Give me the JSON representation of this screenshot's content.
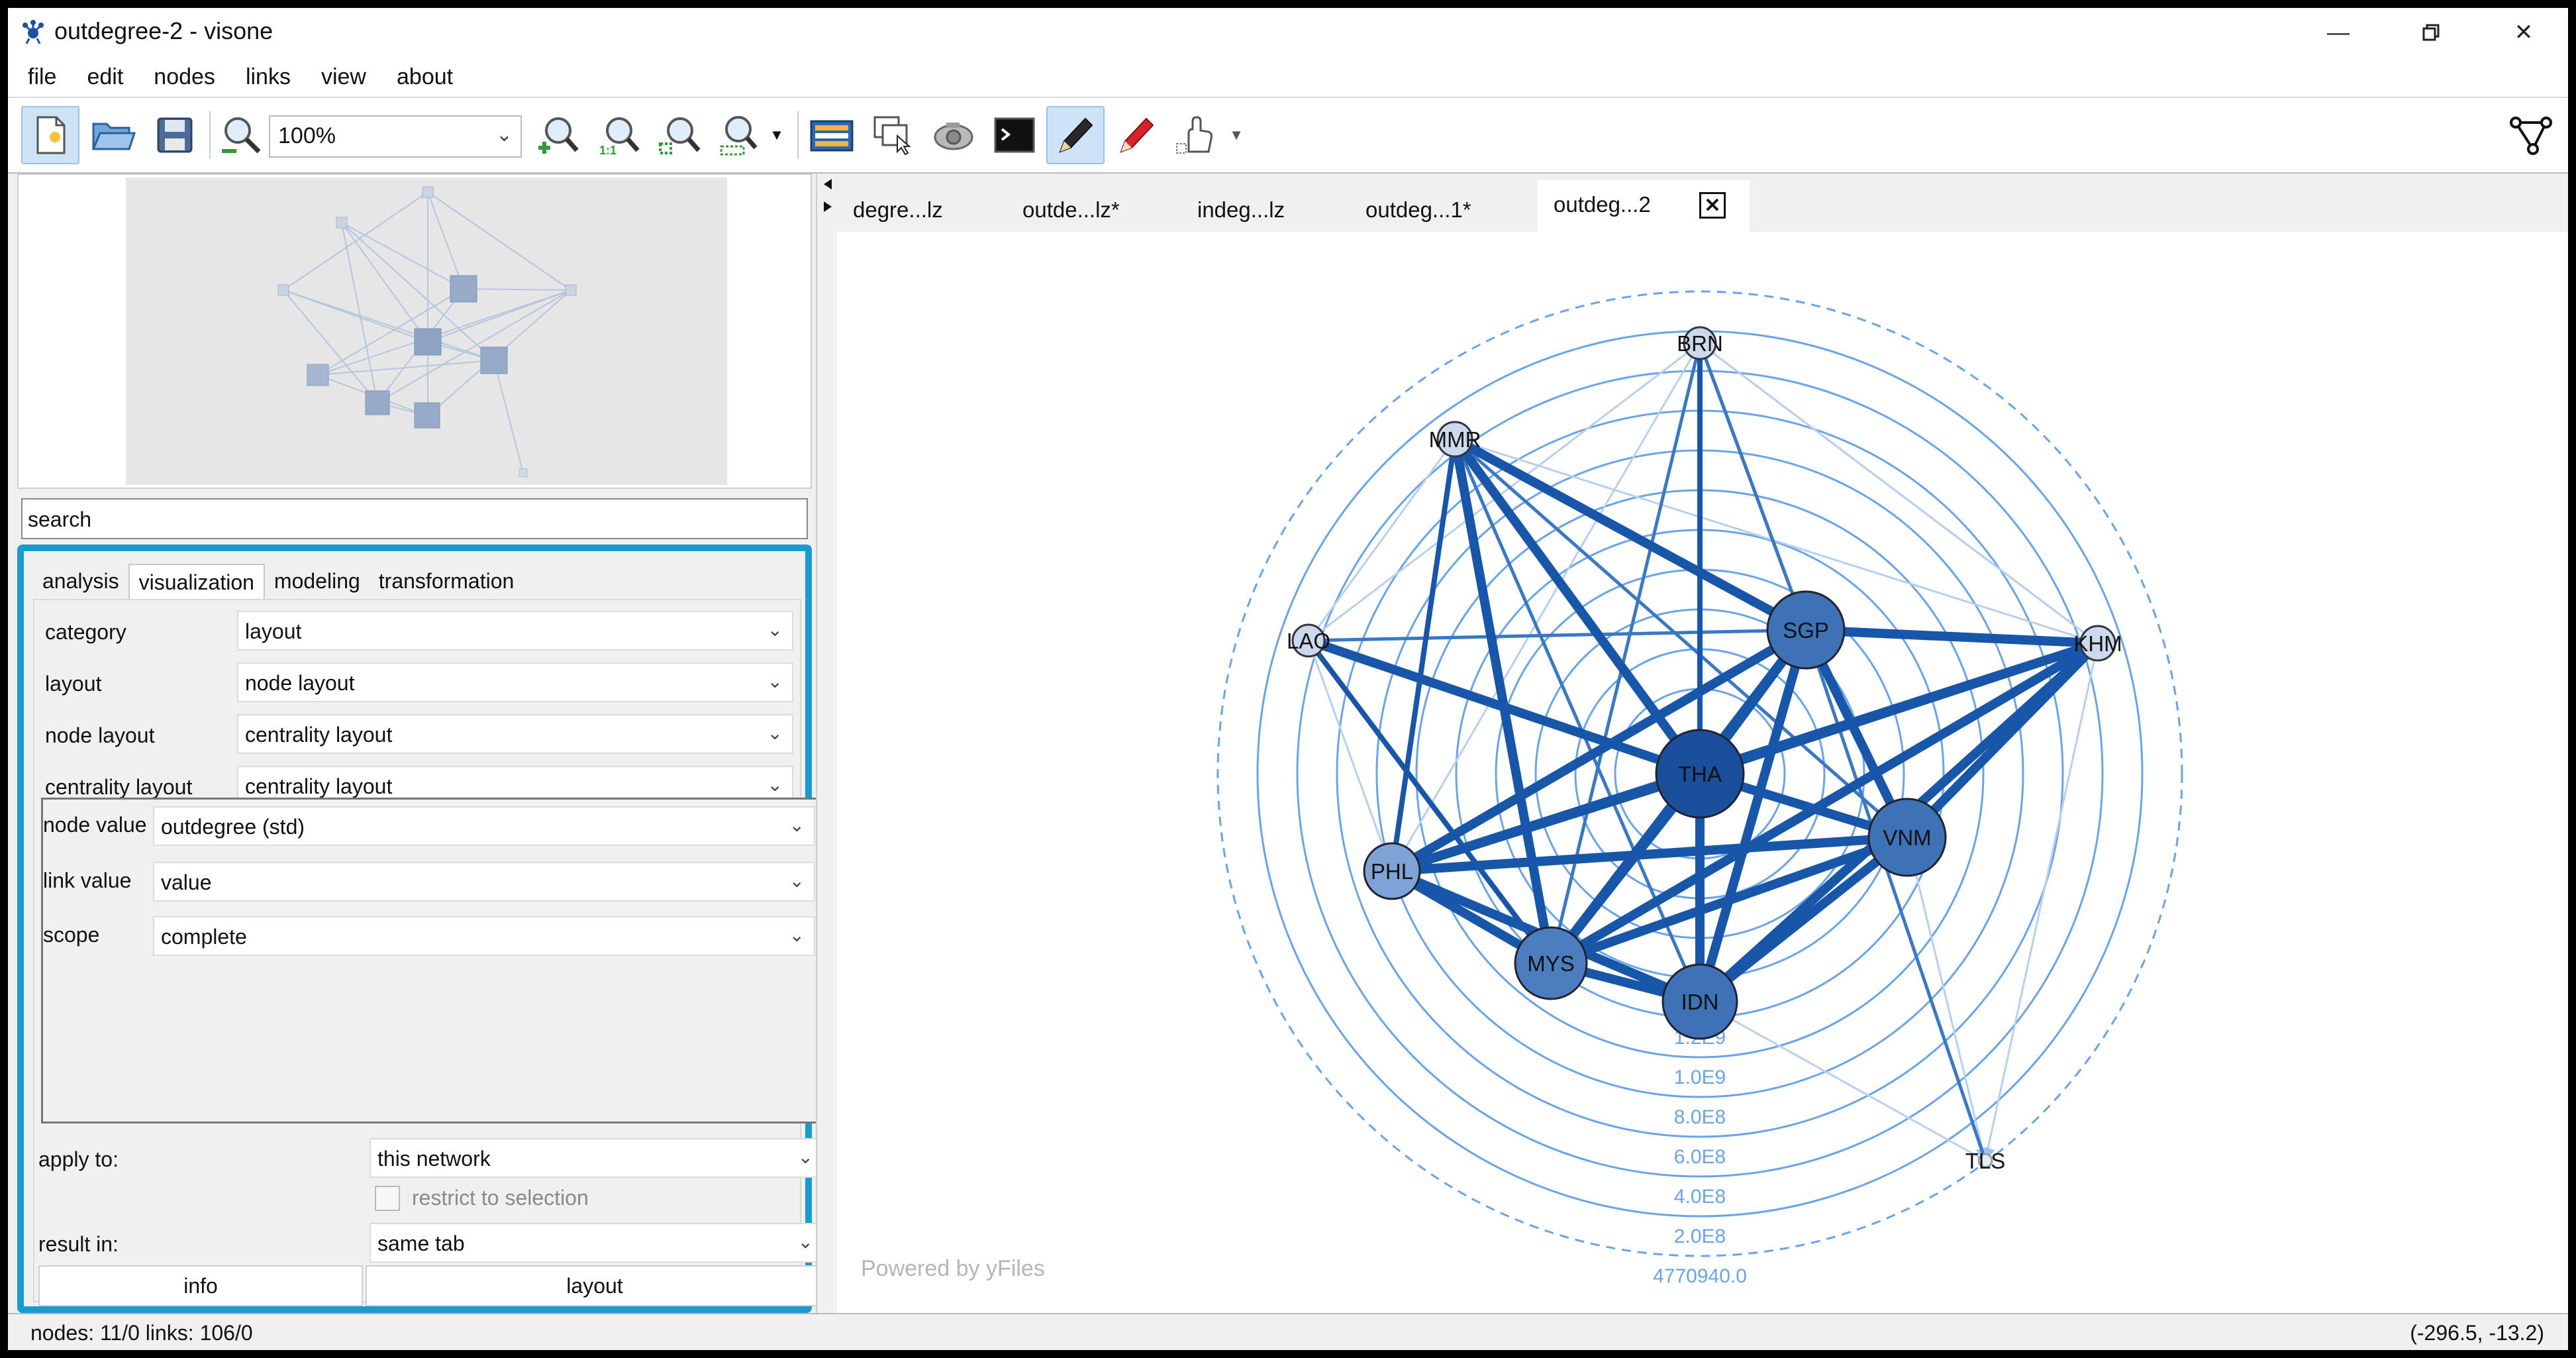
{
  "window": {
    "title": "outdegree-2 - visone"
  },
  "menu": [
    "file",
    "edit",
    "nodes",
    "links",
    "view",
    "about"
  ],
  "toolbar": {
    "zoom_value": "100%"
  },
  "search": {
    "value": "search"
  },
  "panel": {
    "tabs": [
      "analysis",
      "visualization",
      "modeling",
      "transformation"
    ],
    "selected_tab": "visualization",
    "rows": [
      {
        "label": "category",
        "value": "layout"
      },
      {
        "label": "layout",
        "value": "node layout"
      },
      {
        "label": "node layout",
        "value": "centrality layout"
      },
      {
        "label": "centrality layout",
        "value": "centrality layout"
      }
    ],
    "sub_rows": [
      {
        "label": "node value",
        "value": "outdegree (std)"
      },
      {
        "label": "link value",
        "value": "value"
      },
      {
        "label": "scope",
        "value": "complete"
      }
    ],
    "apply_to_label": "apply to:",
    "apply_to_value": "this network",
    "restrict_label": "restrict to selection",
    "result_in_label": "result in:",
    "result_in_value": "same tab",
    "info_button": "info",
    "layout_button": "layout"
  },
  "doc_tabs": [
    "degre...lz",
    "outde...lz*",
    "indeg...lz",
    "outdeg...1*",
    "outdeg...2"
  ],
  "selected_doc_tab": "outdeg...2",
  "graph": {
    "nodes": [
      {
        "id": "BRN",
        "label": "BRN",
        "size": "small"
      },
      {
        "id": "MMR",
        "label": "MMR",
        "size": "small"
      },
      {
        "id": "LAO",
        "label": "LAO",
        "size": "small"
      },
      {
        "id": "KHM",
        "label": "KHM",
        "size": "small"
      },
      {
        "id": "SGP",
        "label": "SGP",
        "size": "large"
      },
      {
        "id": "THA",
        "label": "THA",
        "size": "large"
      },
      {
        "id": "VNM",
        "label": "VNM",
        "size": "large"
      },
      {
        "id": "PHL",
        "label": "PHL",
        "size": "medium"
      },
      {
        "id": "MYS",
        "label": "MYS",
        "size": "large"
      },
      {
        "id": "IDN",
        "label": "IDN",
        "size": "large"
      },
      {
        "id": "TLS",
        "label": "TLS",
        "size": "small"
      }
    ],
    "ring_labels": [
      "1.2E9",
      "1.0E9",
      "8.0E8",
      "6.0E8",
      "4.0E8",
      "2.0E8",
      "4770940.0"
    ]
  },
  "watermark": "Powered by yFiles",
  "status": {
    "left": "nodes: 11/0  links: 106/0",
    "right": "(-296.5, -13.2)"
  },
  "colors": {
    "accent_border": "#1a9bd0",
    "edge": "#1f5fae",
    "node_fill": "#3d72b6",
    "ring": "#6aa4e8"
  }
}
